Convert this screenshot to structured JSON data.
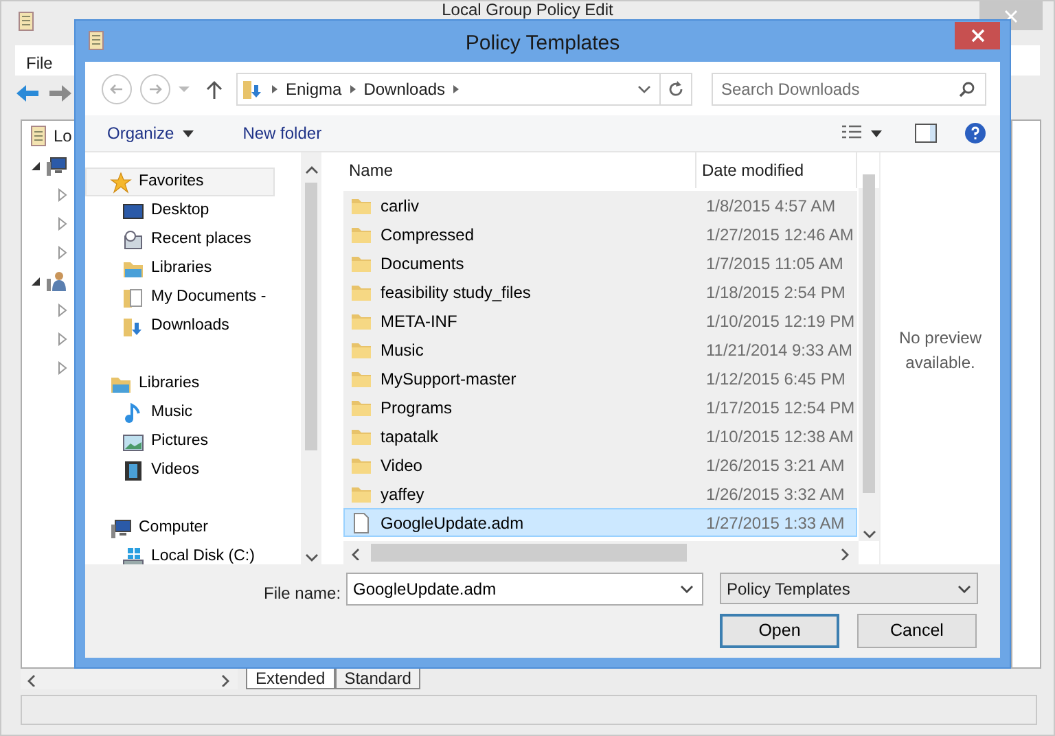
{
  "background_window": {
    "title": "Local Group Policy Edit",
    "menu": [
      "File"
    ],
    "tree": {
      "label": "Lo",
      "children": [
        {
          "kind": "computer",
          "expanded": true,
          "children": [
            {
              "expanded": false
            },
            {
              "expanded": false
            },
            {
              "expanded": false
            }
          ]
        },
        {
          "kind": "user",
          "expanded": true,
          "children": [
            {
              "expanded": false
            },
            {
              "expanded": false
            },
            {
              "expanded": false
            }
          ]
        }
      ]
    },
    "tabs": [
      {
        "label": "Extended",
        "selected": true
      },
      {
        "label": "Standard",
        "selected": false
      }
    ]
  },
  "dialog": {
    "title": "Policy Templates",
    "breadcrumb": [
      "Enigma",
      "Downloads"
    ],
    "search": {
      "placeholder": "Search Downloads"
    },
    "toolbar": [
      "Organize",
      "New folder"
    ],
    "nav": [
      {
        "label": "Favorites",
        "kind": "star",
        "selected": true,
        "children": [
          {
            "label": "Desktop",
            "kind": "desktop"
          },
          {
            "label": "Recent places",
            "kind": "recent"
          },
          {
            "label": "Libraries",
            "kind": "library"
          },
          {
            "label": "My Documents -",
            "kind": "documents"
          },
          {
            "label": "Downloads",
            "kind": "downloads"
          }
        ]
      },
      {
        "label": "Libraries",
        "kind": "library",
        "selected": false,
        "children": [
          {
            "label": "Music",
            "kind": "music"
          },
          {
            "label": "Pictures",
            "kind": "pictures"
          },
          {
            "label": "Videos",
            "kind": "videos"
          }
        ]
      },
      {
        "label": "Computer",
        "kind": "computer",
        "selected": false,
        "children": [
          {
            "label": "Local Disk (C:)",
            "kind": "disk"
          }
        ]
      }
    ],
    "columns": [
      "Name",
      "Date modified"
    ],
    "files": [
      {
        "name": "carliv",
        "date": "1/8/2015 4:57 AM",
        "kind": "folder",
        "selected": false
      },
      {
        "name": "Compressed",
        "date": "1/27/2015 12:46 AM",
        "kind": "folder",
        "selected": false
      },
      {
        "name": "Documents",
        "date": "1/7/2015 11:05 AM",
        "kind": "folder",
        "selected": false
      },
      {
        "name": "feasibility study_files",
        "date": "1/18/2015 2:54 PM",
        "kind": "folder",
        "selected": false
      },
      {
        "name": "META-INF",
        "date": "1/10/2015 12:19 PM",
        "kind": "folder",
        "selected": false
      },
      {
        "name": "Music",
        "date": "11/21/2014 9:33 AM",
        "kind": "folder",
        "selected": false
      },
      {
        "name": "MySupport-master",
        "date": "1/12/2015 6:45 PM",
        "kind": "folder",
        "selected": false
      },
      {
        "name": "Programs",
        "date": "1/17/2015 12:54 PM",
        "kind": "folder",
        "selected": false
      },
      {
        "name": "tapatalk",
        "date": "1/10/2015 12:38 AM",
        "kind": "folder",
        "selected": false
      },
      {
        "name": "Video",
        "date": "1/26/2015 3:21 AM",
        "kind": "folder",
        "selected": false
      },
      {
        "name": "yaffey",
        "date": "1/26/2015 3:32 AM",
        "kind": "folder",
        "selected": false
      },
      {
        "name": "GoogleUpdate.adm",
        "date": "1/27/2015 1:33 AM",
        "kind": "file",
        "selected": true
      }
    ],
    "preview": "No preview available.",
    "file_name": {
      "label": "File name:",
      "value": "GoogleUpdate.adm"
    },
    "file_type": "Policy Templates",
    "buttons": [
      "Open",
      "Cancel"
    ]
  }
}
